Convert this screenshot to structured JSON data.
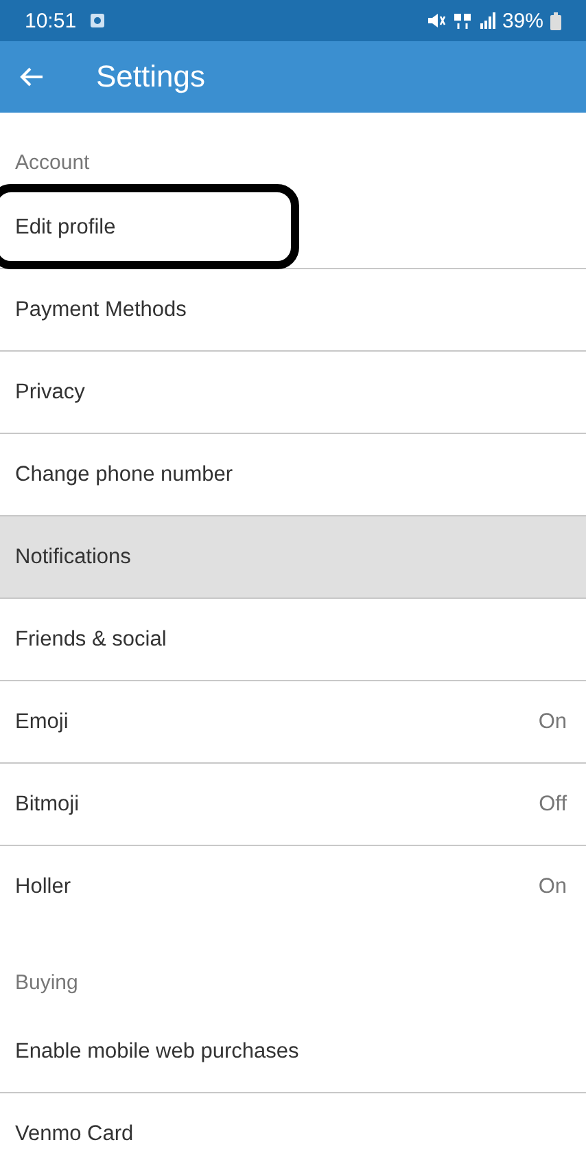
{
  "status_bar": {
    "time": "10:51",
    "battery": "39%"
  },
  "app_bar": {
    "title": "Settings"
  },
  "sections": [
    {
      "title": "Account",
      "items": [
        {
          "label": "Edit profile",
          "selected": false,
          "circled": true
        },
        {
          "label": "Payment Methods",
          "selected": false,
          "circled": false
        },
        {
          "label": "Privacy",
          "selected": false,
          "circled": false
        },
        {
          "label": "Change phone number",
          "selected": false,
          "circled": false
        },
        {
          "label": "Notifications",
          "selected": true,
          "circled": false
        },
        {
          "label": "Friends & social",
          "selected": false,
          "circled": false
        },
        {
          "label": "Emoji",
          "value": "On",
          "selected": false,
          "circled": false
        },
        {
          "label": "Bitmoji",
          "value": "Off",
          "selected": false,
          "circled": false
        },
        {
          "label": "Holler",
          "value": "On",
          "selected": false,
          "circled": false
        }
      ]
    },
    {
      "title": "Buying",
      "items": [
        {
          "label": "Enable mobile web purchases",
          "selected": false,
          "circled": false
        },
        {
          "label": "Venmo Card",
          "selected": false,
          "circled": false
        }
      ]
    }
  ]
}
